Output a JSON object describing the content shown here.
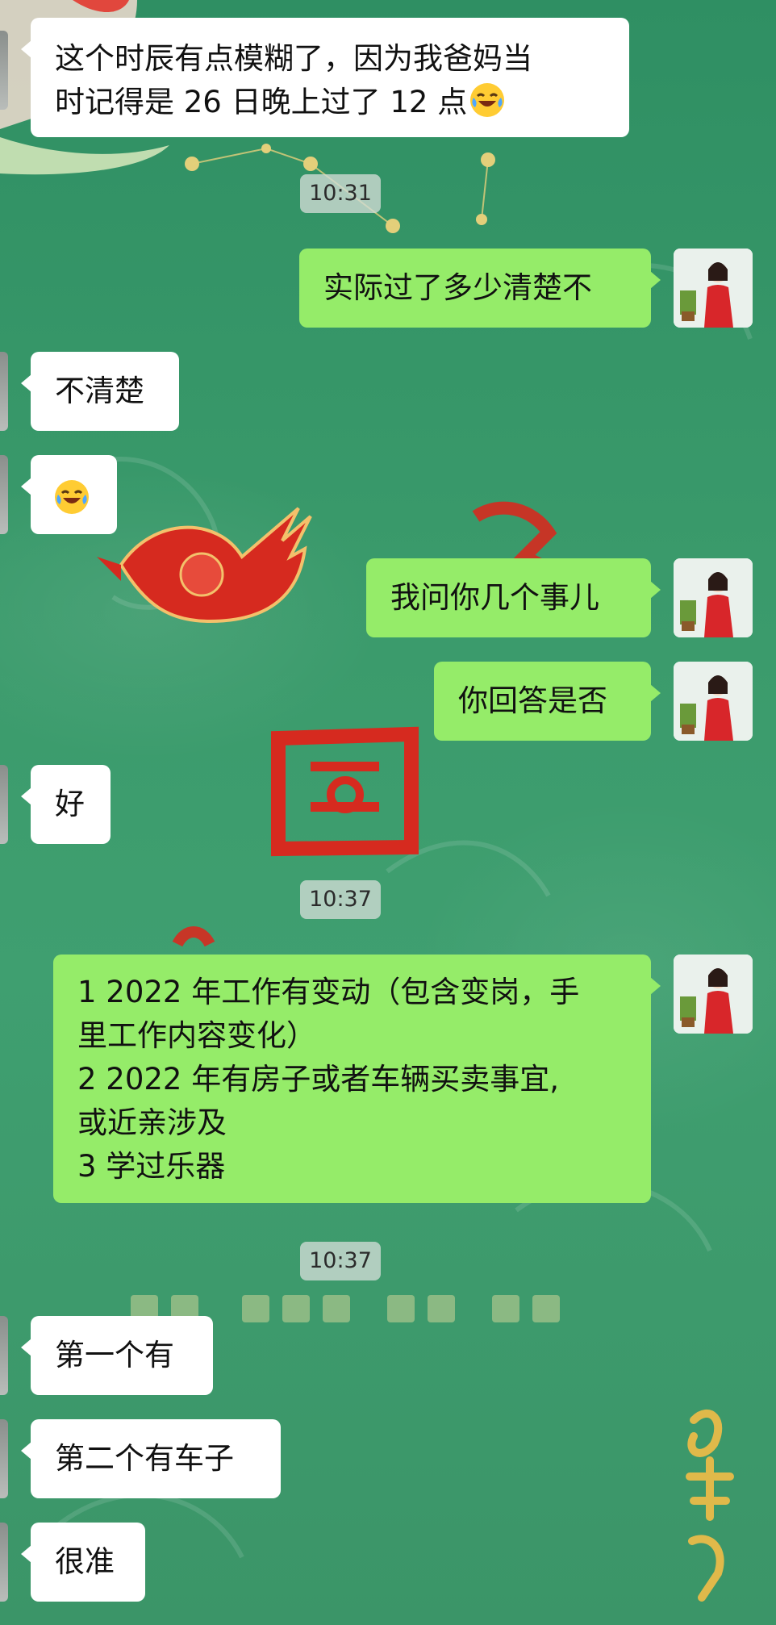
{
  "colors": {
    "background": "#3a9a6b",
    "incoming_bubble": "#ffffff",
    "outgoing_bubble": "#95ec69",
    "timestamp_pill": "#d2dcd6"
  },
  "messages": [
    {
      "dir": "in",
      "lines": [
        "这个时辰有点模糊了，因为我爸妈当",
        "时记得是 26 日晚上过了 12 点"
      ],
      "emoji": "laughing-tears-emoji"
    },
    {
      "dir": "time",
      "text": "10:31"
    },
    {
      "dir": "out",
      "lines": [
        "实际过了多少清楚不"
      ]
    },
    {
      "dir": "in",
      "lines": [
        "不清楚"
      ]
    },
    {
      "dir": "in",
      "lines": [],
      "emoji": "laughing-tears-emoji"
    },
    {
      "dir": "out",
      "lines": [
        "我问你几个事儿"
      ]
    },
    {
      "dir": "out",
      "lines": [
        "你回答是否"
      ]
    },
    {
      "dir": "in",
      "lines": [
        "好"
      ]
    },
    {
      "dir": "time",
      "text": "10:37"
    },
    {
      "dir": "out",
      "lines": [
        "1  2022 年工作有变动（包含变岗，手",
        "里工作内容变化）",
        "2  2022 年有房子或者车辆买卖事宜,",
        "或近亲涉及",
        "3  学过乐器"
      ]
    },
    {
      "dir": "time",
      "text": "10:37"
    },
    {
      "dir": "in",
      "lines": [
        "第一个有"
      ]
    },
    {
      "dir": "in",
      "lines": [
        "第二个有车子"
      ]
    },
    {
      "dir": "in",
      "lines": [
        "很准"
      ]
    }
  ]
}
